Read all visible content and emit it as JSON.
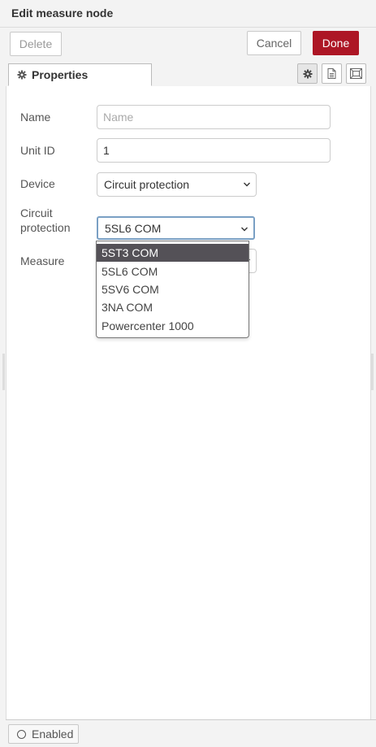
{
  "header": {
    "title": "Edit measure node"
  },
  "actions": {
    "delete_label": "Delete",
    "cancel_label": "Cancel",
    "done_label": "Done"
  },
  "tabs": {
    "properties_label": "Properties"
  },
  "form": {
    "name_label": "Name",
    "name_placeholder": "Name",
    "name_value": "",
    "unit_id_label": "Unit ID",
    "unit_id_value": "1",
    "device_label": "Device",
    "device_value": "Circuit protection",
    "circuit_label_line1": "Circuit",
    "circuit_label_line2": "protection",
    "circuit_value": "5SL6 COM",
    "measure_label": "Measure"
  },
  "dropdown": {
    "options": [
      "5ST3 COM",
      "5SL6 COM",
      "5SV6 COM",
      "3NA COM",
      "Powercenter 1000"
    ],
    "highlighted": "5ST3 COM"
  },
  "footer": {
    "enabled_label": "Enabled"
  },
  "colors": {
    "done_bg": "#ad1625",
    "highlight_bg": "#545157"
  },
  "icons": [
    "gear-icon",
    "settings-icon",
    "description-icon",
    "appearance-icon",
    "chevron-down-icon",
    "toggle-circle-icon"
  ]
}
